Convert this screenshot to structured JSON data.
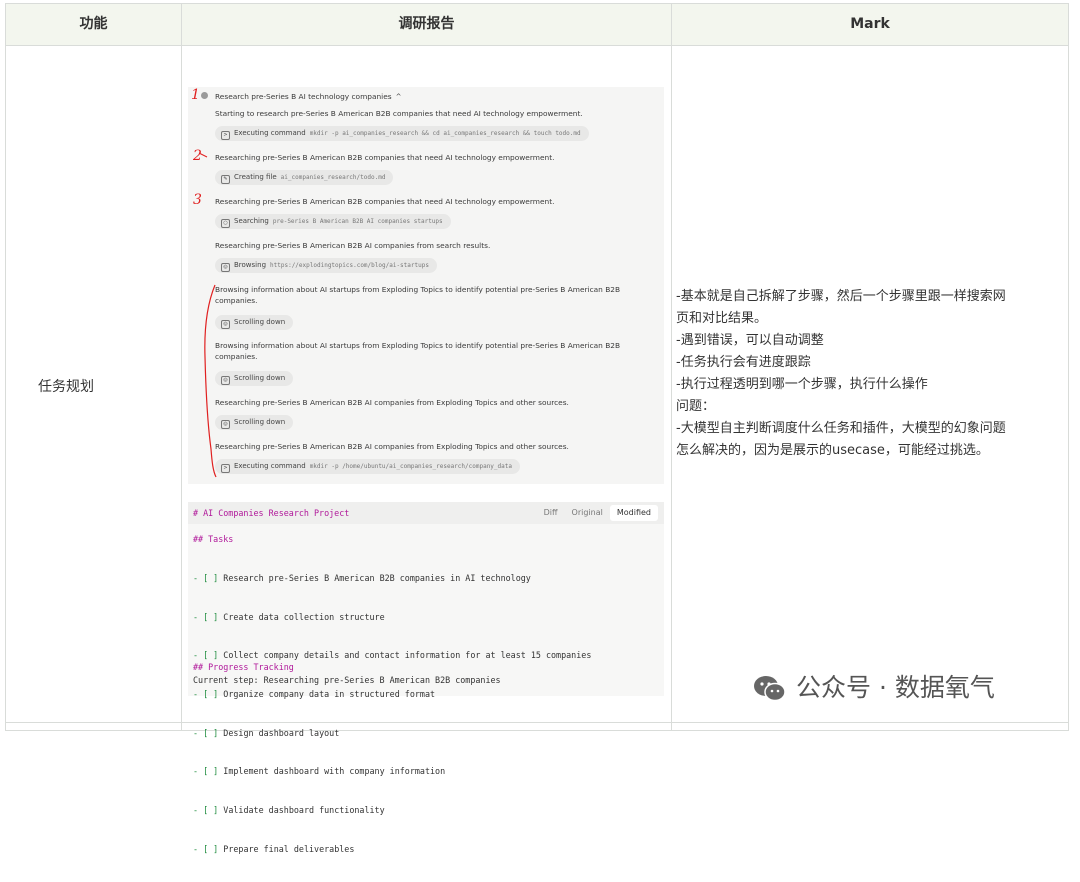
{
  "table": {
    "headers": [
      "功能",
      "调研报告",
      "Mark"
    ],
    "row_label": "任务规划"
  },
  "steps": {
    "title": "Research pre-Series B AI technology companies",
    "intro": "Starting to research pre-Series B American B2B companies that need AI technology empowerment.",
    "items": [
      {
        "type": "pill",
        "label": "Executing command",
        "mono": "mkdir -p ai_companies_research && cd ai_companies_research && touch todo.md"
      },
      {
        "type": "text",
        "text": "Researching pre-Series B American B2B companies that need AI technology empowerment."
      },
      {
        "type": "pill",
        "label": "Creating file",
        "mono": "ai_companies_research/todo.md"
      },
      {
        "type": "text",
        "text": "Researching pre-Series B American B2B companies that need AI technology empowerment."
      },
      {
        "type": "pill",
        "label": "Searching",
        "mono": "pre-Series B American B2B AI companies startups"
      },
      {
        "type": "text",
        "text": "Researching pre-Series B American B2B AI companies from search results."
      },
      {
        "type": "pill",
        "label": "Browsing",
        "mono": "https://explodingtopics.com/blog/ai-startups"
      },
      {
        "type": "text",
        "text": "Browsing information about AI startups from Exploding Topics to identify potential pre-Series B American B2B companies."
      },
      {
        "type": "pill",
        "label": "Scrolling down",
        "mono": ""
      },
      {
        "type": "text",
        "text": "Browsing information about AI startups from Exploding Topics to identify potential pre-Series B American B2B companies."
      },
      {
        "type": "pill",
        "label": "Scrolling down",
        "mono": ""
      },
      {
        "type": "text",
        "text": "Researching pre-Series B American B2B AI companies from Exploding Topics and other sources."
      },
      {
        "type": "pill",
        "label": "Scrolling down",
        "mono": ""
      },
      {
        "type": "text",
        "text": "Researching pre-Series B American B2B AI companies from Exploding Topics and other sources."
      },
      {
        "type": "pill",
        "label": "Executing command",
        "mono": "mkdir -p /home/ubuntu/ai_companies_research/company_data"
      }
    ],
    "annotations": [
      "1",
      "2",
      "3"
    ]
  },
  "code": {
    "heading": "# AI Companies Research Project",
    "tabs": [
      "Diff",
      "Original",
      "Modified"
    ],
    "tasks_heading": "## Tasks",
    "tasks": [
      "- [ ] Research pre-Series B American B2B companies in AI technology",
      "- [ ] Create data collection structure",
      "- [ ] Collect company details and contact information for at least 15 companies",
      "- [ ] Organize company data in structured format",
      "- [ ] Design dashboard layout",
      "- [ ] Implement dashboard with company information",
      "- [ ] Validate dashboard functionality",
      "- [ ] Prepare final deliverables"
    ],
    "progress_heading": "## Progress Tracking",
    "progress_line": "Current step: Researching pre-Series B American B2B companies"
  },
  "mark": {
    "lines": [
      "-基本就是自己拆解了步骤，然后一个步骤里跟一样搜索网",
      "页和对比结果。",
      "-遇到错误，可以自动调整",
      "-任务执行会有进度跟踪",
      "-执行过程透明到哪一个步骤，执行什么操作",
      "问题：",
      "-大模型自主判断调度什么任务和插件，大模型的幻象问题",
      "怎么解决的，因为是展示的usecase，可能经过挑选。"
    ]
  },
  "watermark": {
    "text": "公众号 · 数据氧气",
    "icon": "wechat-icon"
  },
  "colors": {
    "header_bg": "#f3f6ee",
    "border": "#d9dcd9",
    "code_heading": "#b0189a",
    "code_bracket": "#1a8a3a",
    "annotation_red": "#e02020"
  }
}
